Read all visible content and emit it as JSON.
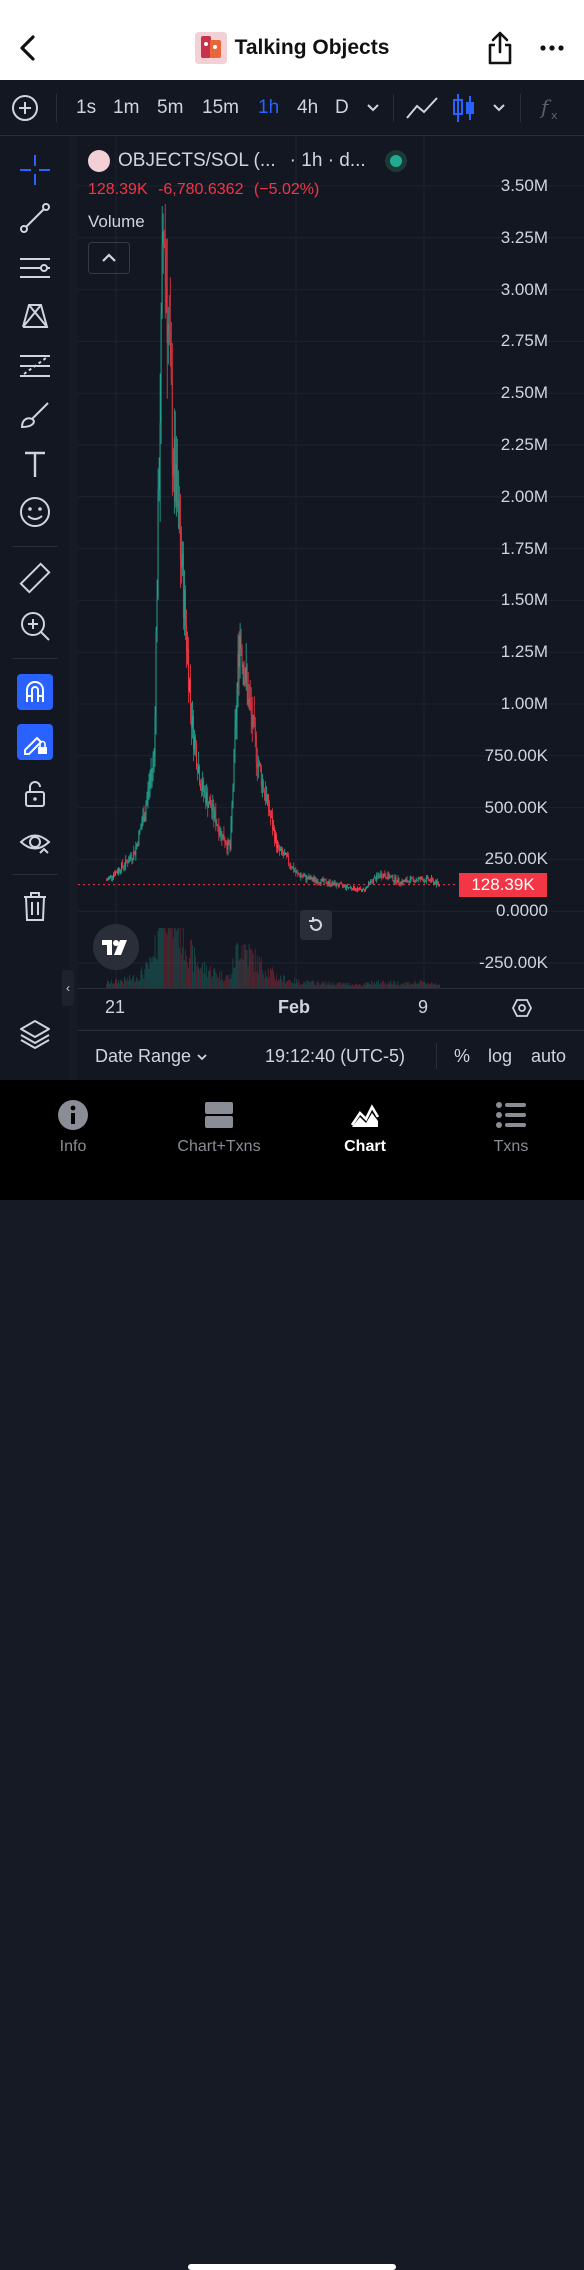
{
  "header": {
    "title": "Talking Objects",
    "icons": [
      "back-chevron-icon",
      "token-logo-icon",
      "share-icon",
      "more-icon"
    ]
  },
  "toolbar": {
    "intervals": [
      "1s",
      "1m",
      "5m",
      "15m",
      "1h",
      "4h",
      "D"
    ],
    "active_interval": "1h",
    "icons": [
      "add-indicator-icon",
      "interval-dropdown-icon",
      "line-chart-icon",
      "candles-icon",
      "style-dropdown-icon",
      "fx-icon"
    ]
  },
  "drawing_tools": [
    "crosshair-icon",
    "trendline-icon",
    "horizontal-lines-icon",
    "pattern-icon",
    "fib-icon",
    "brush-icon",
    "text-icon",
    "emoji-icon",
    "ruler-icon",
    "zoom-in-icon",
    "magnet-icon",
    "lock-drawings-icon",
    "unlock-icon",
    "eye-icon",
    "trash-icon",
    "layers-icon"
  ],
  "legend": {
    "symbol": "OBJECTS/SOL (...",
    "interval_info": "· 1h · d...",
    "price": "128.39K",
    "change": "-6,780.6362",
    "change_pct": "(−5.02%)",
    "volume_label": "Volume"
  },
  "chart_data": {
    "type": "candlestick",
    "x_ticks": [
      "21",
      "Feb",
      "9"
    ],
    "y_ticks": [
      "3.50M",
      "3.25M",
      "3.00M",
      "2.75M",
      "2.50M",
      "2.25M",
      "2.00M",
      "1.75M",
      "1.50M",
      "1.25M",
      "1.00M",
      "750.00K",
      "500.00K",
      "250.00K",
      "0.0000",
      "-250.00K"
    ],
    "ylim": [
      -250000,
      3500000
    ],
    "last_price": 128390,
    "last_price_label": "128.39K",
    "series": [
      {
        "values": [
          150000,
          190000,
          230000,
          290000,
          480000,
          750000,
          3400000,
          2200000,
          1600000,
          900000,
          600000,
          500000,
          380000,
          300000,
          1350000,
          1000000,
          700000,
          500000,
          300000,
          250000,
          180000,
          160000,
          150000,
          140000,
          130000,
          120000,
          110000,
          100000,
          150000,
          180000,
          160000,
          140000,
          150000,
          155000,
          150000,
          128390
        ]
      }
    ],
    "up_color": "#22ab94",
    "down_color": "#f23645"
  },
  "bottom_bar": {
    "date_range": "Date Range",
    "time": "19:12:40 (UTC-5)",
    "percent": "%",
    "log": "log",
    "auto": "auto"
  },
  "tabs": [
    {
      "label": "Info",
      "icon": "info-icon"
    },
    {
      "label": "Chart+Txns",
      "icon": "split-view-icon"
    },
    {
      "label": "Chart",
      "icon": "chart-icon",
      "active": true
    },
    {
      "label": "Txns",
      "icon": "list-icon"
    }
  ]
}
